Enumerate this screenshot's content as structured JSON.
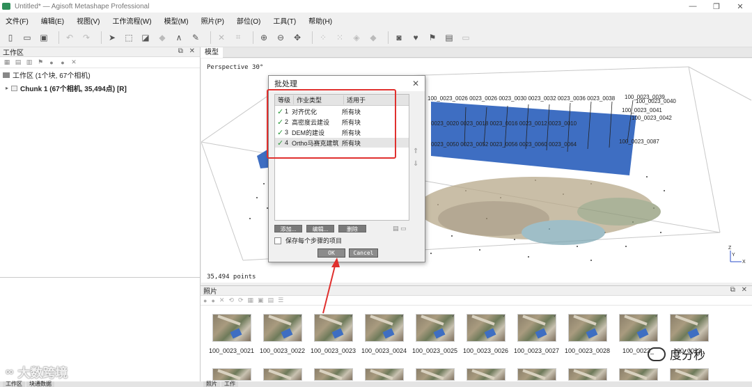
{
  "window": {
    "title": "Untitled* — Agisoft Metashape Professional",
    "controls": [
      "—",
      "❐",
      "✕"
    ]
  },
  "menu": [
    "文件(F)",
    "编辑(E)",
    "视图(V)",
    "工作流程(W)",
    "模型(M)",
    "照片(P)",
    "部位(O)",
    "工具(T)",
    "帮助(H)"
  ],
  "workspace": {
    "header": "工作区",
    "root_label": "工作区 (1个块, 67个相机)",
    "chunk_label": "Chunk 1 (67个相机, 35,494点) [R]"
  },
  "model": {
    "tab": "模型",
    "perspective": "Perspective 30°",
    "points": "35,494 points",
    "camera_labels": [
      "100_0023_0039",
      "100_0023_0040",
      "100_0023_0041",
      "100_0023_0042",
      "100_0023_0087"
    ]
  },
  "photos": {
    "header": "照片",
    "items": [
      "100_0023_0021",
      "100_0023_0022",
      "100_0023_0023",
      "100_0023_0024",
      "100_0023_0025",
      "100_0023_0026",
      "100_0023_0027",
      "100_0023_0028",
      "100_0023_",
      "100_0023_"
    ]
  },
  "bottom_tabs": [
    "工作区",
    "块通数据",
    "照片",
    "工作"
  ],
  "dialog": {
    "title": "批处理",
    "columns": [
      "等级",
      "作业类型",
      "适用于"
    ],
    "jobs": [
      {
        "num": "1",
        "type": "对齐优化",
        "apply": "所有块"
      },
      {
        "num": "2",
        "type": "高密度云建设",
        "apply": "所有块"
      },
      {
        "num": "3",
        "type": "DEM的建设",
        "apply": "所有块"
      },
      {
        "num": "4",
        "type": "Ortho马赛克建筑",
        "apply": "所有块"
      }
    ],
    "add": "添加...",
    "edit": "编辑...",
    "delete": "删除",
    "save_option": "保存每个步骤的项目",
    "ok": "OK",
    "cancel": "Cancel"
  },
  "watermarks": {
    "left": "大数跨境",
    "right": "度分秒"
  },
  "colors": {
    "annotation_red": "#e0302e",
    "ortho_blue": "#3e6ec2",
    "check_green": "#2a9a3a"
  }
}
